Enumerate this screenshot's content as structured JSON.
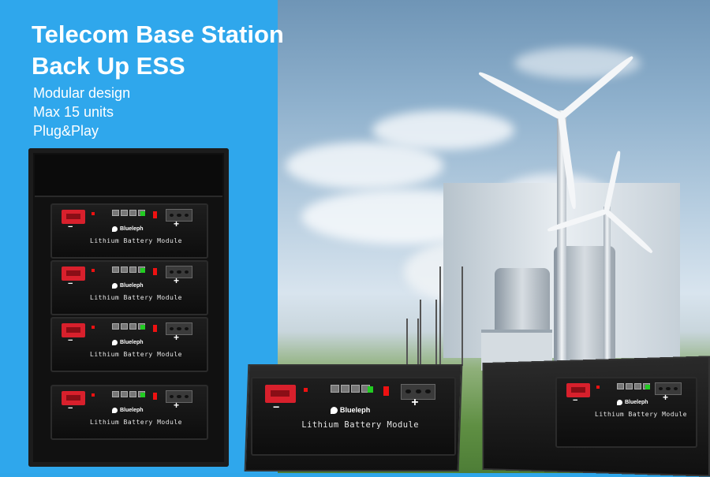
{
  "headline": {
    "line1": "Telecom Base Station",
    "line2": "Back Up ESS"
  },
  "features": [
    "Modular design",
    "Max 15 units",
    "Plug&Play"
  ],
  "module": {
    "brand": "Blueleph",
    "label": "Lithium Battery Module",
    "minus": "−",
    "plus": "+"
  },
  "colors": {
    "panel_blue": "#2fa7ec",
    "terminal_red": "#d8202c",
    "module_black": "#111111"
  }
}
